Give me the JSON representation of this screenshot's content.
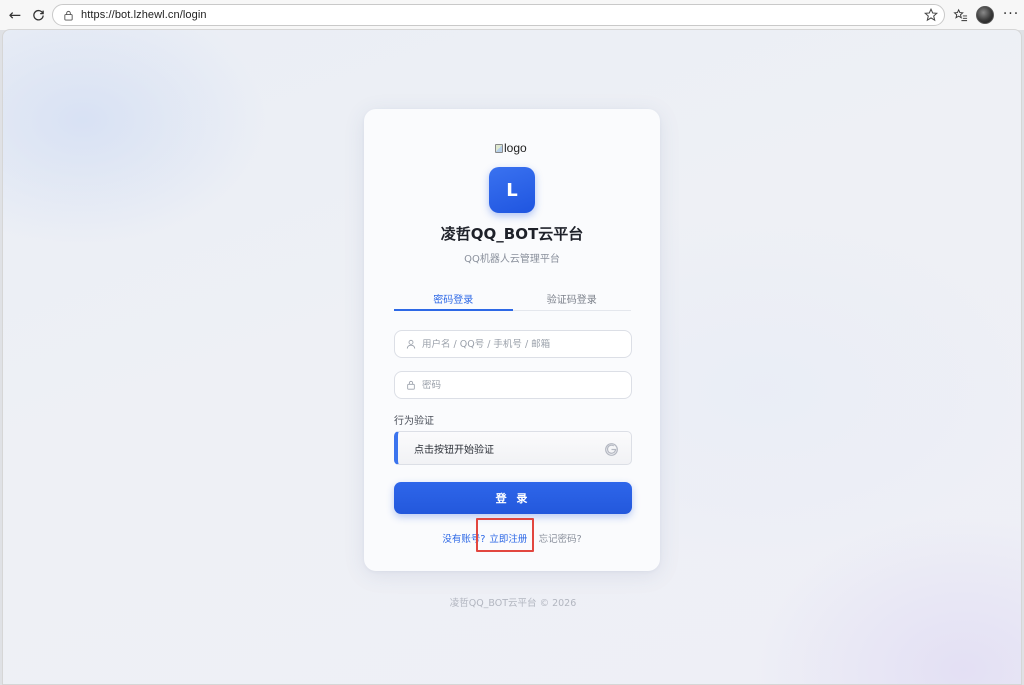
{
  "browser": {
    "url": "https://bot.lzhewl.cn/login",
    "back_icon": "←",
    "reload_icon": "C",
    "star_icon": "☆",
    "favorites_icon": "☆≡",
    "more_icon": "···"
  },
  "login": {
    "logo_alt": "logo",
    "brand_letter": "L",
    "title": "凌哲QQ_BOT云平台",
    "subtitle": "QQ机器人云管理平台",
    "tabs": [
      {
        "label": "密码登录",
        "active": true
      },
      {
        "label": "验证码登录",
        "active": false
      }
    ],
    "username_placeholder": "用户名 / QQ号 / 手机号 / 邮箱",
    "password_placeholder": "密码",
    "captcha_label": "行为验证",
    "captcha_prompt": "点击按钮开始验证",
    "login_button": "登 录",
    "no_account_text": "没有账号?",
    "register_link": "立即注册",
    "divider": "|",
    "forgot_link": "忘记密码?",
    "accent_color": "#2d68e6"
  },
  "footer": {
    "copyright": "凌哲QQ_BOT云平台 © 2026"
  }
}
